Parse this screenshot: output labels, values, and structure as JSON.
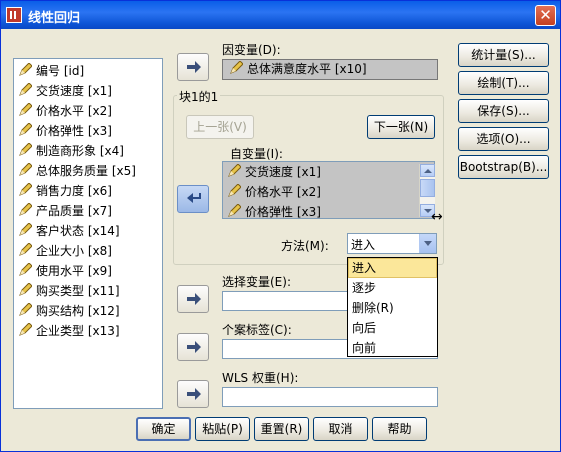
{
  "window": {
    "title": "线性回归",
    "close_symbol": "✕"
  },
  "variables": [
    "编号 [id]",
    "交货速度 [x1]",
    "价格水平 [x2]",
    "价格弹性 [x3]",
    "制造商形象 [x4]",
    "总体服务质量 [x5]",
    "销售力度 [x6]",
    "产品质量 [x7]",
    "客户状态 [x14]",
    "企业大小 [x8]",
    "使用水平 [x9]",
    "购买类型 [x11]",
    "购买结构 [x12]",
    "企业类型 [x13]"
  ],
  "dependent": {
    "label": "因变量(D):",
    "value": "总体满意度水平 [x10]"
  },
  "block": {
    "title": "块1的1",
    "prev": "上一张(V)",
    "next": "下一张(N)"
  },
  "independent": {
    "label": "自变量(I):",
    "items": [
      "交货速度 [x1]",
      "价格水平 [x2]",
      "价格弹性 [x3]"
    ]
  },
  "method": {
    "label": "方法(M):",
    "value": "进入",
    "options": [
      "进入",
      "逐步",
      "删除(R)",
      "向后",
      "向前"
    ]
  },
  "selection_var": {
    "label": "选择变量(E):"
  },
  "case_label": {
    "label": "个案标签(C):"
  },
  "wls_weight": {
    "label": "WLS 权重(H):"
  },
  "side_buttons": [
    "统计量(S)...",
    "绘制(T)...",
    "保存(S)...",
    "选项(O)...",
    "Bootstrap(B)..."
  ],
  "bottom_buttons": [
    "确定",
    "粘贴(P)",
    "重置(R)",
    "取消",
    "帮助"
  ],
  "colors": {
    "titlebar": "#0a5ee8",
    "dropdown_highlight": "#fbe79a",
    "filled_field": "#c4c4c4"
  }
}
